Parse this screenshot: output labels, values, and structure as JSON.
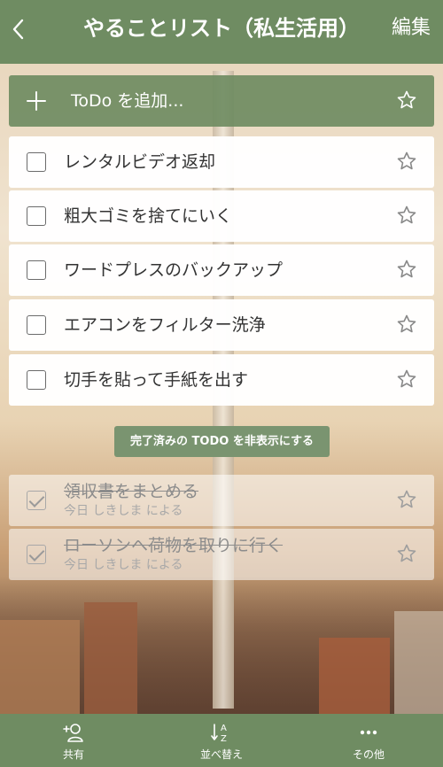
{
  "header": {
    "back_icon": "chevron-left-icon",
    "title": "やることリスト（私生活用）",
    "edit_label": "編集",
    "color": "#6f8c62"
  },
  "add_bar": {
    "plus_icon": "plus-icon",
    "placeholder": "ToDo を追加...",
    "star_icon": "star-outline-icon"
  },
  "todos": [
    {
      "label": "レンタルビデオ返却",
      "checked": false,
      "starred": false
    },
    {
      "label": "粗大ゴミを捨てにいく",
      "checked": false,
      "starred": false
    },
    {
      "label": "ワードプレスのバックアップ",
      "checked": false,
      "starred": false
    },
    {
      "label": "エアコンをフィルター洗浄",
      "checked": false,
      "starred": false
    },
    {
      "label": "切手を貼って手紙を出す",
      "checked": false,
      "starred": false
    }
  ],
  "hide_completed_label": "完了済みの TODO を非表示にする",
  "completed": [
    {
      "label": "領収書をまとめる",
      "sub": "今日 しきしま による",
      "checked": true,
      "starred": false
    },
    {
      "label": "ローソンへ荷物を取りに行く",
      "sub": "今日 しきしま による",
      "checked": true,
      "starred": false
    }
  ],
  "toolbar": {
    "share_label": "共有",
    "share_icon": "add-person-icon",
    "sort_label": "並べ替え",
    "sort_icon": "sort-az-icon",
    "more_label": "その他",
    "more_icon": "more-dots-icon"
  },
  "star_glyph": "☆",
  "plus_glyph": "＋",
  "back_glyph": "‹"
}
